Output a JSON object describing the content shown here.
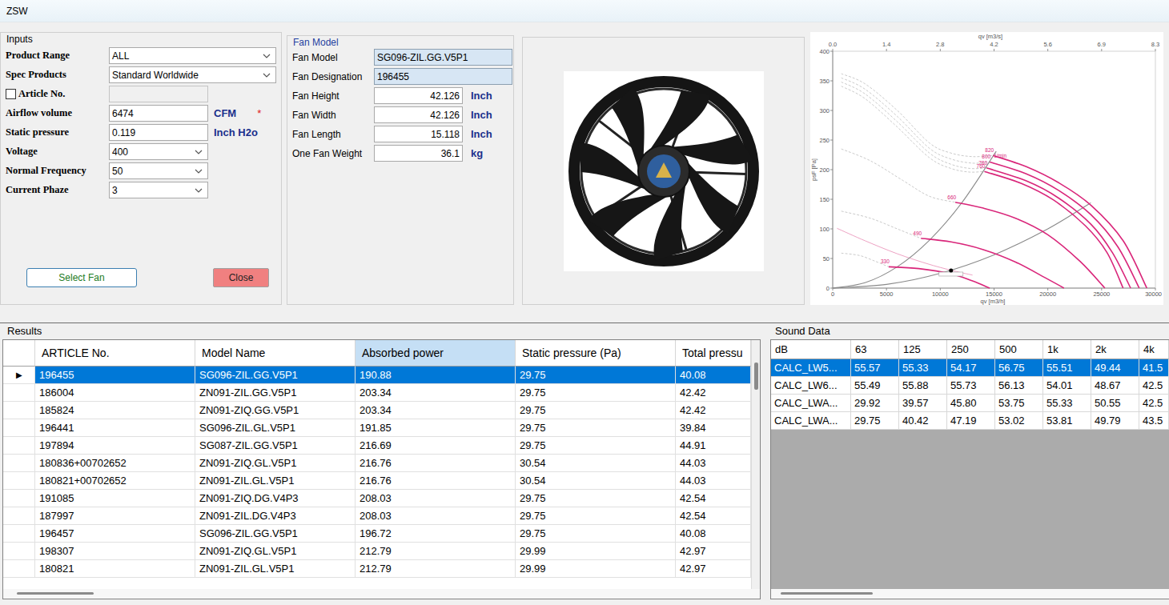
{
  "window": {
    "title": "ZSW"
  },
  "inputs": {
    "title": "Inputs",
    "fields": [
      {
        "label": "Product Range",
        "kind": "wide-select",
        "value": "ALL",
        "disabled": false
      },
      {
        "label": "Spec Products",
        "kind": "wide-select",
        "value": "Standard Worldwide",
        "disabled": false
      },
      {
        "label": "Article No.",
        "kind": "check-text",
        "checked": false,
        "value": "",
        "disabled": true
      },
      {
        "label": "Airflow volume",
        "kind": "text",
        "value": "6474",
        "unit": "CFM",
        "required": "*",
        "disabled": false
      },
      {
        "label": "Static pressure",
        "kind": "text",
        "value": "0.119",
        "unit": "Inch H2o",
        "disabled": false
      },
      {
        "label": "Voltage",
        "kind": "select",
        "value": "400",
        "disabled": false
      },
      {
        "label": "Normal Frequency",
        "kind": "select",
        "value": "50",
        "disabled": false
      },
      {
        "label": "Current Phaze",
        "kind": "select",
        "value": "3",
        "disabled": false
      }
    ],
    "buttons": [
      {
        "label": "Select Fan",
        "kind": "select"
      },
      {
        "label": "Close",
        "kind": "close"
      }
    ]
  },
  "fan_model": {
    "title": "Fan Model",
    "fields": [
      {
        "label": "Fan Model",
        "kind": "readonly",
        "value": "SG096-ZIL.GG.V5P1"
      },
      {
        "label": "Fan Designation",
        "kind": "readonly",
        "value": "196455"
      },
      {
        "label": "Fan Height",
        "kind": "measure",
        "value": "42.126",
        "unit": "Inch"
      },
      {
        "label": "Fan Width",
        "kind": "measure",
        "value": "42.126",
        "unit": "Inch"
      },
      {
        "label": "Fan Length",
        "kind": "measure",
        "value": "15.118",
        "unit": "Inch"
      },
      {
        "label": "One Fan Weight",
        "kind": "measure",
        "value": "36.1",
        "unit": "kg"
      }
    ]
  },
  "chart": {
    "top_axis": {
      "title": "qv [m3/s]",
      "ticks": [
        "0.0",
        "1.4",
        "2.8",
        "4.2",
        "5.6",
        "6.9",
        "8.3"
      ]
    },
    "bottom_axis": {
      "title": "qv [m3/h]",
      "ticks": [
        "0",
        "5000",
        "10000",
        "15000",
        "20000",
        "25000",
        "30000"
      ]
    },
    "left_axis": {
      "title": "psF [Pa]",
      "ticks": [
        "0",
        "50",
        "100",
        "150",
        "200",
        "250",
        "300",
        "350",
        "400"
      ]
    },
    "rpm_unit": "1/min",
    "series": [
      {
        "kind": "stall",
        "points": [
          [
            800,
            362
          ],
          [
            3000,
            345
          ],
          [
            6000,
            300
          ],
          [
            9000,
            245
          ],
          [
            11000,
            228
          ],
          [
            13000,
            222
          ],
          [
            14900,
            224
          ]
        ]
      },
      {
        "kind": "stall",
        "points": [
          [
            800,
            355
          ],
          [
            3000,
            336
          ],
          [
            6000,
            290
          ],
          [
            9000,
            236
          ],
          [
            11000,
            218
          ],
          [
            13000,
            211
          ],
          [
            14600,
            213
          ]
        ]
      },
      {
        "kind": "stall",
        "points": [
          [
            800,
            348
          ],
          [
            3000,
            328
          ],
          [
            6000,
            281
          ],
          [
            9000,
            228
          ],
          [
            11000,
            209
          ],
          [
            12800,
            202
          ],
          [
            14300,
            203
          ]
        ]
      },
      {
        "kind": "stall",
        "points": [
          [
            800,
            341
          ],
          [
            3000,
            320
          ],
          [
            6000,
            272
          ],
          [
            9000,
            220
          ],
          [
            11000,
            202
          ],
          [
            12700,
            196
          ],
          [
            14100,
            197
          ]
        ]
      },
      {
        "kind": "stall",
        "points": [
          [
            800,
            235
          ],
          [
            3500,
            215
          ],
          [
            6500,
            182
          ],
          [
            9000,
            155
          ],
          [
            11400,
            145
          ]
        ]
      },
      {
        "kind": "stall",
        "points": [
          [
            800,
            130
          ],
          [
            3500,
            118
          ],
          [
            6000,
            100
          ],
          [
            8200,
            84
          ]
        ]
      },
      {
        "kind": "stall",
        "points": [
          [
            800,
            59
          ],
          [
            2500,
            55
          ],
          [
            4000,
            45
          ],
          [
            5200,
            36
          ]
        ]
      },
      {
        "kind": "limit",
        "points": [
          [
            400,
            101
          ],
          [
            3000,
            80
          ],
          [
            6000,
            58
          ],
          [
            9000,
            40
          ],
          [
            11500,
            28
          ],
          [
            13000,
            22
          ]
        ]
      },
      {
        "kind": "system",
        "points": [
          [
            0,
            0
          ],
          [
            3000,
            9
          ],
          [
            6000,
            36
          ],
          [
            9000,
            81
          ],
          [
            12000,
            144
          ],
          [
            15200,
            231
          ]
        ]
      },
      {
        "kind": "system",
        "points": [
          [
            0,
            0
          ],
          [
            5000,
            6.25
          ],
          [
            10000,
            25
          ],
          [
            15000,
            56.25
          ],
          [
            20000,
            100
          ],
          [
            24000,
            144
          ]
        ]
      },
      {
        "kind": "fan",
        "label": "820",
        "points": [
          [
            14900,
            224
          ],
          [
            18000,
            205
          ],
          [
            21000,
            178
          ],
          [
            24000,
            140
          ],
          [
            27000,
            80
          ],
          [
            29200,
            0
          ]
        ]
      },
      {
        "kind": "fan",
        "label": "800",
        "points": [
          [
            14600,
            213
          ],
          [
            18000,
            193
          ],
          [
            21000,
            165
          ],
          [
            24000,
            124
          ],
          [
            26500,
            70
          ],
          [
            28500,
            0
          ]
        ]
      },
      {
        "kind": "fan",
        "label": "780",
        "points": [
          [
            14300,
            203
          ],
          [
            18000,
            181
          ],
          [
            21000,
            152
          ],
          [
            24000,
            108
          ],
          [
            26000,
            60
          ],
          [
            27700,
            0
          ]
        ]
      },
      {
        "kind": "fan",
        "label": "760",
        "points": [
          [
            14100,
            197
          ],
          [
            17500,
            177
          ],
          [
            20500,
            149
          ],
          [
            23500,
            105
          ],
          [
            25500,
            60
          ],
          [
            27000,
            0
          ]
        ]
      },
      {
        "kind": "fan",
        "label": "660",
        "points": [
          [
            11400,
            145
          ],
          [
            14000,
            135
          ],
          [
            17000,
            118
          ],
          [
            20000,
            90
          ],
          [
            23000,
            45
          ],
          [
            25300,
            0
          ]
        ]
      },
      {
        "kind": "fan",
        "label": "490",
        "points": [
          [
            8200,
            84
          ],
          [
            11000,
            78
          ],
          [
            14000,
            65
          ],
          [
            17000,
            44
          ],
          [
            20000,
            15
          ],
          [
            21500,
            0
          ]
        ]
      },
      {
        "kind": "fan",
        "label": "330",
        "points": [
          [
            5200,
            36
          ],
          [
            8000,
            33
          ],
          [
            11000,
            24
          ],
          [
            13000,
            12
          ],
          [
            14600,
            0
          ]
        ]
      }
    ],
    "operating_point": {
      "flow": 11000,
      "pressure": 29.75
    }
  },
  "results": {
    "title": "Results",
    "row_marker": "▶",
    "columns": [
      {
        "label": "ARTICLE No.",
        "selected": false
      },
      {
        "label": "Model Name",
        "selected": false
      },
      {
        "label": "Absorbed power",
        "selected": true
      },
      {
        "label": "Static pressure (Pa)",
        "selected": false
      },
      {
        "label": "Total pressu",
        "selected": false
      }
    ],
    "rows": [
      {
        "selected": true,
        "cells": [
          "196455",
          "SG096-ZIL.GG.V5P1",
          "190.88",
          "29.75",
          "40.08"
        ]
      },
      {
        "selected": false,
        "cells": [
          "186004",
          "ZN091-ZIL.GG.V5P1",
          "203.34",
          "29.75",
          "42.42"
        ]
      },
      {
        "selected": false,
        "cells": [
          "185824",
          "ZN091-ZIQ.GG.V5P1",
          "203.34",
          "29.75",
          "42.42"
        ]
      },
      {
        "selected": false,
        "cells": [
          "196441",
          "SG096-ZIL.GL.V5P1",
          "191.85",
          "29.75",
          "39.84"
        ]
      },
      {
        "selected": false,
        "cells": [
          "197894",
          "SG087-ZIL.GG.V5P1",
          "216.69",
          "29.75",
          "44.91"
        ]
      },
      {
        "selected": false,
        "cells": [
          "180836+00702652",
          "ZN091-ZIQ.GL.V5P1",
          "216.76",
          "30.54",
          "44.03"
        ]
      },
      {
        "selected": false,
        "cells": [
          "180821+00702652",
          "ZN091-ZIL.GL.V5P1",
          "216.76",
          "30.54",
          "44.03"
        ]
      },
      {
        "selected": false,
        "cells": [
          "191085",
          "ZN091-ZIQ.DG.V4P3",
          "208.03",
          "29.75",
          "42.54"
        ]
      },
      {
        "selected": false,
        "cells": [
          "187997",
          "ZN091-ZIL.DG.V4P3",
          "208.03",
          "29.75",
          "42.54"
        ]
      },
      {
        "selected": false,
        "cells": [
          "196457",
          "SG096-ZIL.GG.V5P1",
          "196.72",
          "29.75",
          "40.08"
        ]
      },
      {
        "selected": false,
        "cells": [
          "198307",
          "ZN091-ZIQ.GL.V5P1",
          "212.79",
          "29.99",
          "42.97"
        ]
      },
      {
        "selected": false,
        "cells": [
          "180821",
          "ZN091-ZIL.GL.V5P1",
          "212.79",
          "29.99",
          "42.97"
        ]
      }
    ]
  },
  "sound": {
    "title": "Sound Data",
    "columns": [
      "dB",
      "63",
      "125",
      "250",
      "500",
      "1k",
      "2k",
      "4k"
    ],
    "rows": [
      {
        "selected": true,
        "cells": [
          "CALC_LW5...",
          "55.57",
          "55.33",
          "54.17",
          "56.75",
          "55.51",
          "49.44",
          "41.5"
        ]
      },
      {
        "selected": false,
        "cells": [
          "CALC_LW6...",
          "55.49",
          "55.88",
          "55.73",
          "56.13",
          "54.01",
          "48.67",
          "42.5"
        ]
      },
      {
        "selected": false,
        "cells": [
          "CALC_LWA...",
          "29.92",
          "39.57",
          "45.80",
          "53.75",
          "55.33",
          "50.55",
          "42.5"
        ]
      },
      {
        "selected": false,
        "cells": [
          "CALC_LWA...",
          "29.75",
          "40.42",
          "47.19",
          "53.02",
          "53.81",
          "49.79",
          "43.5"
        ]
      }
    ]
  }
}
